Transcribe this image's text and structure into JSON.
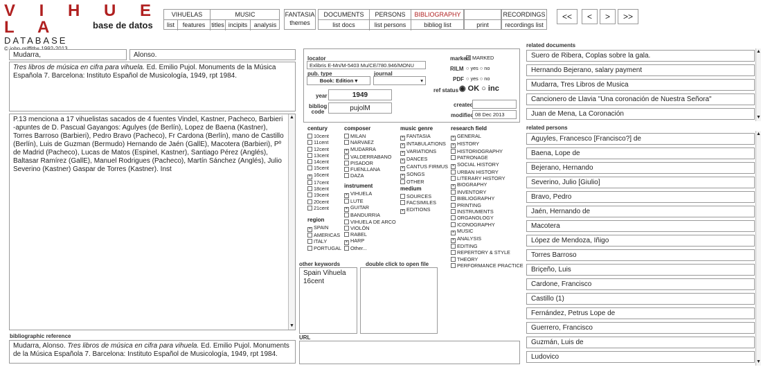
{
  "logo": {
    "title": "V I H U E L A",
    "subtitle": "DATABASE",
    "tagline": "base de datos",
    "copyright": "© john griffiths 1992-2013"
  },
  "nav": {
    "vihuelas": {
      "label": "VIHUELAS",
      "subs": [
        "list",
        "features"
      ]
    },
    "music": {
      "label": "MUSIC",
      "subs": [
        "titles",
        "incipits",
        "analysis"
      ]
    },
    "fantasia": {
      "label": "FANTASIA",
      "sub": "themes"
    },
    "documents": {
      "label": "DOCUMENTS",
      "sub": "list docs"
    },
    "persons": {
      "label": "PERSONS",
      "sub": "list persons"
    },
    "bibliography": {
      "label": "BIBLIOGRAPHY",
      "subs": [
        "bibliog list",
        "print"
      ]
    },
    "recordings": {
      "label": "RECORDINGS",
      "sub": "recordings list"
    },
    "arrows": [
      "<<",
      "<",
      ">",
      ">>"
    ]
  },
  "record": {
    "last_name": "Mudarra,",
    "first_name": "Alonso.",
    "citation_italic": "Tres libros de música en cifra para vihuela.",
    "citation_rest": " Ed. Emilio Pujol. Monuments de la Música Española 7.  Barcelona: Instituto Español de Musicología, 1949, rpt 1984.",
    "notes": "P.13 menciona a 17 vihuelistas sacados de 4 fuentes Vindel, Kastner, Pacheco, Barbieri -apuntes de D. Pascual Gayangos: Agulyes (de Berlín), Lopez de Baena (Kastner), Torres Barroso (Barbieri), Pedro Bravo (Pacheco), Fr Cardona (Berlín), mano de Castillo (Berlín), Luis de Guzman (Bermudo) Hernando de Jaén (GallE), Macotera (Barbieri), Pº de Madrid (Pacheco), Lucas de Matos (Espinel, Kastner), Santiago Pérez (Anglés), Baltasar Ramírez (GallE), Manuel Rodrigues (Pacheco), Martín Sánchez (Anglés), Julio Severino (Kastner) Gaspar de Torres (Kastner). Inst",
    "bib_ref_label": "bibliographic reference",
    "bib_ref_pre": "Mudarra, Alonso. ",
    "bib_ref_italic": "Tres libros de música en cifra para vihuela.",
    "bib_ref_rest": "  Ed. Emilio Pujol. Monuments de la Música Española 7.  Barcelona: Instituto Español de Musicología, 1949, rpt 1984."
  },
  "meta": {
    "locator_label": "locator",
    "locator": "Exlibris E-Mn/M-5403 Mu/CE/780.946/MONU",
    "pubtype_label": "pub. type",
    "pubtype": "Book: Edition",
    "journal_label": "journal",
    "year_label": "year",
    "year": "1949",
    "bibliog_label": "bibliog code",
    "bibliog_code": "pujolM",
    "marked_label": "marked",
    "marked_value": "MARKED",
    "rilm_label": "RILM",
    "pdf_label": "PDF",
    "yes": "yes",
    "no": "no",
    "refstatus_label": "ref status",
    "ok": "OK",
    "inc": "inc",
    "created_label": "created",
    "created": "",
    "modified_label": "modified",
    "modified": "08 Dec 2013"
  },
  "categories": {
    "century": {
      "label": "century",
      "items": [
        [
          "10cent",
          false
        ],
        [
          "11cent",
          false
        ],
        [
          "12cent",
          false
        ],
        [
          "13cent",
          false
        ],
        [
          "14cent",
          false
        ],
        [
          "15cent",
          false
        ],
        [
          "16cent",
          true
        ],
        [
          "17cent",
          false
        ],
        [
          "18cent",
          false
        ],
        [
          "19cent",
          false
        ],
        [
          "20cent",
          false
        ],
        [
          "21cent",
          false
        ]
      ]
    },
    "region": {
      "label": "region",
      "items": [
        [
          "SPAIN",
          true
        ],
        [
          "AMERICAS",
          false
        ],
        [
          "ITALY",
          false
        ],
        [
          "PORTUGAL",
          false
        ]
      ]
    },
    "composer": {
      "label": "composer",
      "items": [
        [
          "MILAN",
          false
        ],
        [
          "NARVAEZ",
          false
        ],
        [
          "MUDARRA",
          true
        ],
        [
          "VALDERRABANO",
          false
        ],
        [
          "PISADOR",
          false
        ],
        [
          "FUENLLANA",
          false
        ],
        [
          "DAZA",
          false
        ]
      ]
    },
    "instrument": {
      "label": "instrument",
      "items": [
        [
          "VIHUELA",
          true
        ],
        [
          "LUTE",
          false
        ],
        [
          "GUITAR",
          true
        ],
        [
          "BANDURRIA",
          false
        ],
        [
          "VIHUELA DE ARCO",
          false
        ],
        [
          "VIOLÓN",
          false
        ],
        [
          "RABEL",
          false
        ],
        [
          "HARP",
          true
        ],
        [
          "Other...",
          false
        ]
      ]
    },
    "genre": {
      "label": "music genre",
      "items": [
        [
          "FANTASIA",
          true
        ],
        [
          "INTABULATIONS",
          true
        ],
        [
          "VARIATIONS",
          true
        ],
        [
          "DANCES",
          true
        ],
        [
          "CANTUS FIRMUS",
          true
        ],
        [
          "SONGS",
          true
        ],
        [
          "OTHER",
          false
        ]
      ]
    },
    "medium": {
      "label": "medium",
      "items": [
        [
          "SOURCES",
          false
        ],
        [
          "FACSIMILES",
          false
        ],
        [
          "EDITIONS",
          true
        ]
      ]
    },
    "research": {
      "label": "research field",
      "items": [
        [
          "GENERAL",
          true
        ],
        [
          "HISTORY",
          true
        ],
        [
          "HISTORIOGRAPHY",
          false
        ],
        [
          "PATRONAGE",
          false
        ],
        [
          "SOCIAL HISTORY",
          true
        ],
        [
          "URBAN HISTORY",
          false
        ],
        [
          "LITERARY HISTORY",
          false
        ],
        [
          "BIOGRAPHY",
          true
        ],
        [
          "INVENTORY",
          false
        ],
        [
          "BIBLIOGRAPHY",
          false
        ],
        [
          "PRINTING",
          false
        ],
        [
          "INSTRUMENTS",
          false
        ],
        [
          "ORGANOLOGY",
          false
        ],
        [
          "ICONOGRAPHY",
          false
        ],
        [
          "MUSIC",
          true
        ],
        [
          "ANALYSIS",
          true
        ],
        [
          "EDITING",
          false
        ],
        [
          "REPERTORY & STYLE",
          false
        ],
        [
          "THEORY",
          false
        ],
        [
          "PERFORMANCE PRACTICE",
          false
        ]
      ]
    }
  },
  "keywords": {
    "label": "other keywords",
    "value": "Spain Vihuela\n16cent",
    "file_label": "double click to open file",
    "url_label": "URL"
  },
  "related_documents": {
    "label": "related documents",
    "items": [
      "Suero de Ribera, Coplas sobre la gala.",
      "Hernando Bejerano, salary payment",
      "Mudarra, Tres Libros de Musica",
      "Cancionero de Llavia \"Una coronación de Nuestra Señora\"",
      "Juan de Mena, La Coronación"
    ]
  },
  "related_persons": {
    "label": "related persons",
    "items": [
      "Aguyles, Francesco [Francisco?] de",
      "Baena, Lope de",
      "Bejerano, Hernando",
      "Severino, Julio [Giulio]",
      "Bravo, Pedro",
      "Jaén, Hernando de",
      "Macotera",
      "López de Mendoza, Iñigo",
      "Torres Barroso",
      "Briçeño, Luis",
      "Cardone, Francisco",
      "Castillo (1)",
      "Fernández, Petrus Lope de",
      "Guerrero, Francisco",
      "Guzmán, Luis de",
      "Ludovico"
    ]
  }
}
